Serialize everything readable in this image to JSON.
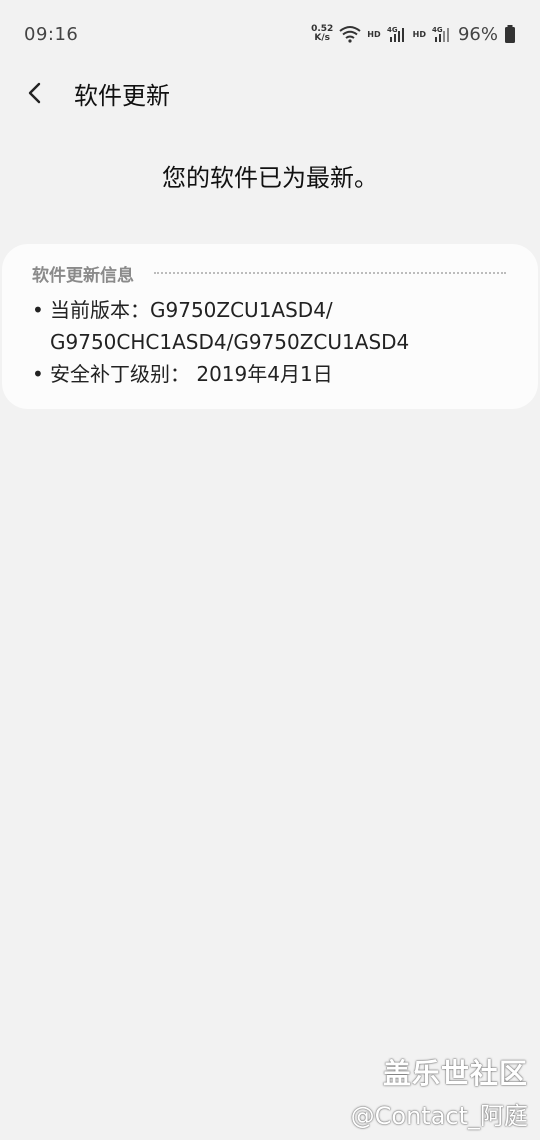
{
  "status_bar": {
    "time": "09:16",
    "net_speed_value": "0.52",
    "net_speed_unit": "K/s",
    "hd1": "HD",
    "hd2": "HD",
    "battery": "96%"
  },
  "header": {
    "title": "软件更新"
  },
  "message": "您的软件已为最新。",
  "info_card": {
    "title": "软件更新信息",
    "items": [
      {
        "line1": "当前版本：G9750ZCU1ASD4/",
        "line2": "G9750CHC1ASD4/G9750ZCU1ASD4"
      },
      {
        "line1": "安全补丁级别： 2019年4月1日"
      }
    ]
  },
  "watermark": {
    "title": "盖乐世社区",
    "user": "@Contact_阿庭"
  }
}
